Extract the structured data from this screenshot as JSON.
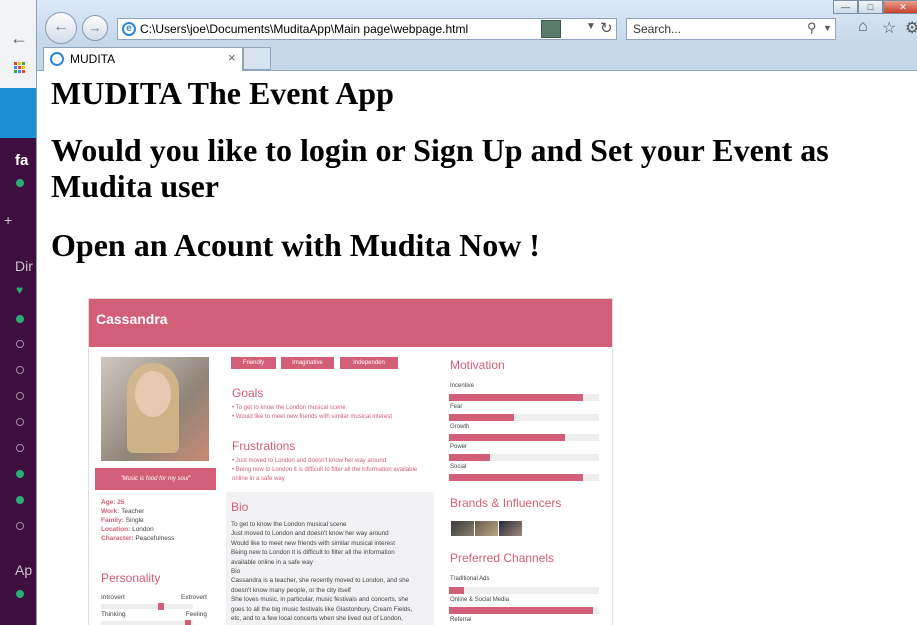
{
  "browser": {
    "address": "C:\\Users\\joe\\Documents\\MuditaApp\\Main page\\webpage.html",
    "search_placeholder": "Search...",
    "tab_title": "MUDITA",
    "tab_close": "×"
  },
  "background_app": {
    "workspace_initial": "fa",
    "section_dir": "Dir",
    "section_apps": "Ap",
    "plus": "+"
  },
  "page": {
    "title": "MUDITA The Event App",
    "heading2": "Would you like to login or Sign Up and Set your Event as Mudita user",
    "heading3": "Open an Acount with Mudita Now !"
  },
  "persona": {
    "name": "Cassandra",
    "quote": "\"Music is food for my soul\"",
    "facts": [
      {
        "key": "Age",
        "value": "25"
      },
      {
        "key": "Work",
        "value": "Teacher"
      },
      {
        "key": "Family",
        "value": "Single"
      },
      {
        "key": "Location",
        "value": "London"
      },
      {
        "key": "Character",
        "value": "Peacefulness"
      }
    ],
    "traits": [
      "Friendly",
      "Imaginative",
      "Independen"
    ],
    "goals_title": "Goals",
    "goals": [
      "To get to know the London musical scene",
      "Would like to meet new friends with similar musical interest"
    ],
    "frustrations_title": "Frustrations",
    "frustrations": [
      "Just moved to London and doesn't know her way around",
      "Being new to London it is difficult to filter all the information available online in a safe way"
    ],
    "bio_title": "Bio",
    "bio_lines": [
      "To get to know the London musical scene",
      "Just moved to London and doesn't know her way around",
      "Would like to meet new friends with similar musical interest",
      "Being new to London it is difficult to filter all the information",
      "available online in a safe way",
      "Bio",
      "Cassandra is a teacher, she recently moved to London, and she",
      "doesn't know many people, or the city itself",
      "She loves music, in particular, music festivals and concerts, she",
      "goes to all the big music festivals like Glastonbury, Cream Fields,",
      "etc, and to a few local concerts when she lived out of London,"
    ],
    "personality_title": "Personality",
    "personality": [
      {
        "left": "Introvert",
        "right": "Extrovert",
        "level": 0.65
      },
      {
        "left": "Thinking",
        "right": "Feeling",
        "level": 0.95
      }
    ],
    "motivation_title": "Motivation",
    "motivation": [
      {
        "label": "Incentive",
        "value": 0.89
      },
      {
        "label": "Fear",
        "value": 0.43
      },
      {
        "label": "Growth",
        "value": 0.77
      },
      {
        "label": "Power",
        "value": 0.27
      },
      {
        "label": "Social",
        "value": 0.89
      }
    ],
    "brands_title": "Brands & Influencers",
    "channels_title": "Preferred Channels",
    "channels": [
      {
        "label": "Traditional Ads",
        "value": 0.1
      },
      {
        "label": "Online & Social Media",
        "value": 0.96
      },
      {
        "label": "Referral",
        "value": 0
      }
    ]
  }
}
